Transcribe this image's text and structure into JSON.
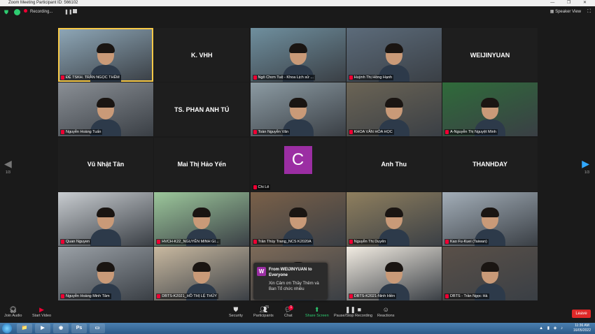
{
  "window": {
    "title": "Zoom Meeting Participant ID: 566102",
    "controls": "—  ❐  ✕"
  },
  "topbar": {
    "recording_label": "Recording...",
    "speaker_view_label": "Speaker View"
  },
  "tiles": [
    {
      "name": "ĐỆ TSKH. TRẦN NGỌC THÊM",
      "video": true,
      "active": true,
      "bg": "#8fa8b8"
    },
    {
      "name": "K. VHH",
      "video": false
    },
    {
      "name": "Ngô Chơn Tuệ - Khoa Lịch sử ...",
      "video": true,
      "bg": "#6f8f9e"
    },
    {
      "name": "Huỳnh Thị Hồng Hạnh",
      "video": true,
      "bg": "#5c6b7a"
    },
    {
      "name": "WEIJINYUAN",
      "video": false
    },
    {
      "name": "Nguyễn Hoàng Tuấn",
      "video": true,
      "bg": "#8a8f95"
    },
    {
      "name": "TS. PHAN ANH TÚ",
      "video": false
    },
    {
      "name": "Toàn Nguyễn Văn",
      "video": true,
      "bg": "#8c9ba3"
    },
    {
      "name": "KHOA VĂN HÓA HỌC",
      "video": true,
      "bg": "#6b6455"
    },
    {
      "name": "A-Nguyễn Thị Nguyệt Minh",
      "video": true,
      "bg": "#2f6b3a"
    },
    {
      "name": "Vũ Nhật Tân",
      "video": false
    },
    {
      "name": "Mai Thị Hảo Yến",
      "video": false
    },
    {
      "name": "Chi Lê",
      "video": false,
      "avatar": "C"
    },
    {
      "name": "Anh Thu",
      "video": false
    },
    {
      "name": "THANHDAY",
      "video": false
    },
    {
      "name": "Quan Nguyen",
      "video": true,
      "bg": "#c8ccd0"
    },
    {
      "name": "HVCH-K22_NGUYỄN MINH GI...",
      "video": true,
      "bg": "#9cc79b"
    },
    {
      "name": "Trần Thùy Trang_NCS K2020A",
      "video": true,
      "bg": "#7a6048"
    },
    {
      "name": "Nguyễn Thị Duyên",
      "video": true,
      "bg": "#8f7f5e"
    },
    {
      "name": "Kao Fu-Kuei (Taiwan)",
      "video": true,
      "bg": "#a3aeb8"
    },
    {
      "name": "Nguyễn Hoàng Minh Tâm",
      "video": true,
      "bg": "#9aa0a6"
    },
    {
      "name": "DBTS-K2021_HỒ THỊ LỆ THỦY",
      "video": true,
      "bg": "#c9b9a0"
    },
    {
      "name": "",
      "video": true,
      "bg": "#7d6a58"
    },
    {
      "name": "DBTS-K2021-Ninh Hiền",
      "video": true,
      "bg": "#f2ece2"
    },
    {
      "name": "DBTS - Trần Ngọc Hà",
      "video": true,
      "bg": "#5a5048"
    }
  ],
  "pagination": {
    "left": "1/3",
    "right": "1/3"
  },
  "chat": {
    "from": "From WEIJINYUAN to Everyone",
    "message": "Xin Cảm ơn Thầy Thêm và Ban Tổ chức nhiều",
    "avatar": "W"
  },
  "toolbar": {
    "join_audio": "Join Audio",
    "start_video": "Start Video",
    "security": "Security",
    "participants": "Participants",
    "participants_count": "75",
    "chat": "Chat",
    "chat_badge": "1",
    "share_screen": "Share Screen",
    "record": "Pause/Stop Recording",
    "reactions": "Reactions",
    "leave": "Leave"
  },
  "taskbar": {
    "clock_time": "11:36 AM",
    "clock_date": "16/05/2022",
    "apps": [
      "📁",
      "▶",
      "◉",
      "Ps",
      "▭"
    ]
  }
}
